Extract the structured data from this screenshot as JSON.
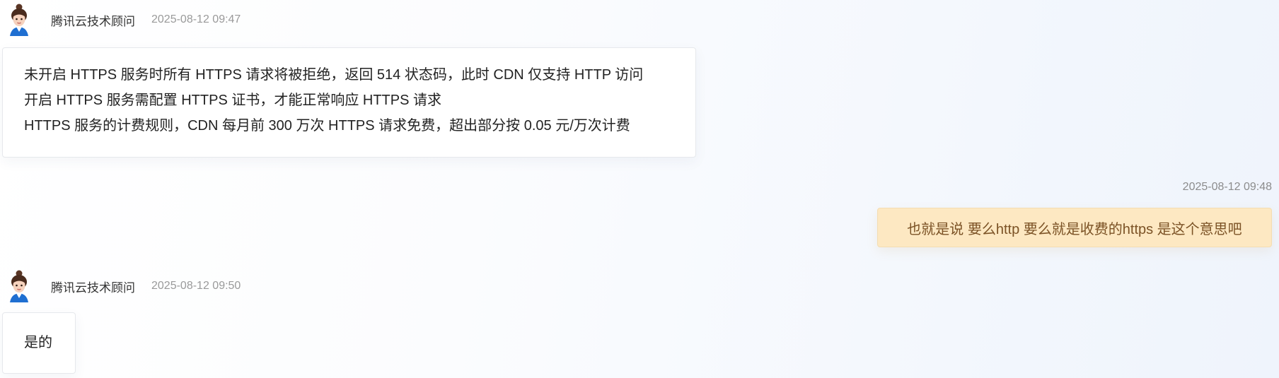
{
  "conversation": {
    "messages": [
      {
        "sender": "腾讯云技术顾问",
        "time": "2025-08-12 09:47",
        "avatar_icon": "advisor-avatar-icon",
        "lines": [
          "未开启 HTTPS 服务时所有 HTTPS 请求将被拒绝，返回 514 状态码，此时 CDN 仅支持 HTTP 访问",
          "开启 HTTPS 服务需配置 HTTPS 证书，才能正常响应 HTTPS 请求",
          "HTTPS 服务的计费规则，CDN 每月前 300 万次 HTTPS 请求免费，超出部分按 0.05 元/万次计费"
        ]
      },
      {
        "sender": "user",
        "time": "2025-08-12 09:48",
        "text": "也就是说 要么http 要么就是收费的https 是这个意思吧"
      },
      {
        "sender": "腾讯云技术顾问",
        "time": "2025-08-12 09:50",
        "avatar_icon": "advisor-avatar-icon",
        "lines": [
          "是的"
        ]
      }
    ]
  },
  "colors": {
    "user_bubble_bg": "#fde8c2",
    "user_bubble_text": "#7b5225",
    "timestamp": "#9a9a9a"
  }
}
